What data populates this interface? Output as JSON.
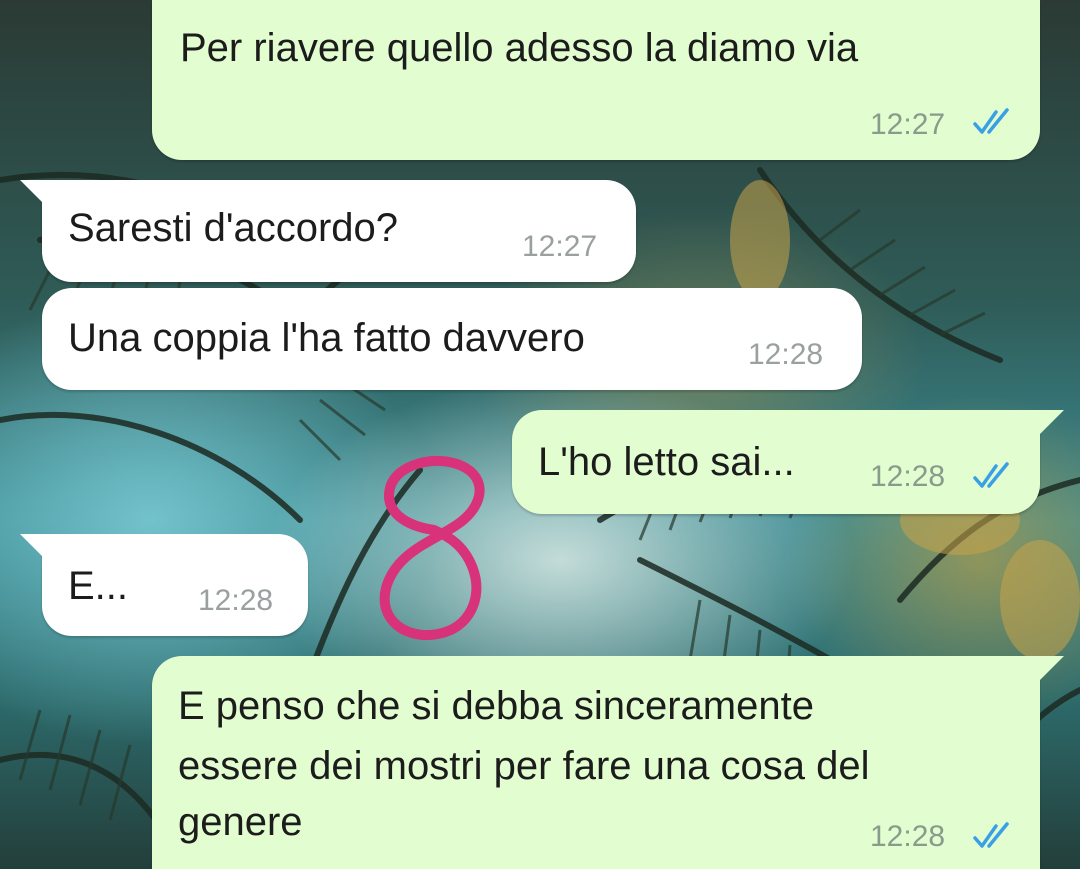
{
  "chat": {
    "messages": [
      {
        "direction": "out",
        "text": "Per riavere quello adesso la diamo via",
        "time": "12:27",
        "status": "read"
      },
      {
        "direction": "in",
        "text": "Saresti d'accordo?",
        "time": "12:27"
      },
      {
        "direction": "in",
        "text": "Una coppia l'ha fatto davvero",
        "time": "12:28"
      },
      {
        "direction": "out",
        "text": "L'ho letto sai...",
        "time": "12:28",
        "status": "read"
      },
      {
        "direction": "in",
        "text": "E...",
        "time": "12:28"
      },
      {
        "direction": "out",
        "lines": [
          "E penso che si debba sinceramente",
          "essere dei mostri per fare una cosa del",
          "genere"
        ],
        "time": "12:28",
        "status": "read"
      }
    ]
  },
  "annotation": {
    "glyph": "8",
    "color": "#d8327a"
  },
  "colors": {
    "outgoing_bubble": "#e2fdd0",
    "incoming_bubble": "#ffffff",
    "read_ticks": "#3aa0e6"
  }
}
